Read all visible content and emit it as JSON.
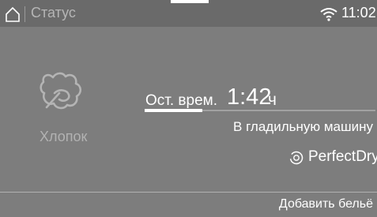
{
  "header": {
    "title": "Статус",
    "time": "11:02",
    "home_icon": "home-icon",
    "wifi_icon": "wifi-icon"
  },
  "program": {
    "name": "Хлопок",
    "icon": "cotton-icon"
  },
  "remaining": {
    "label": "Ост. врем.",
    "value": "1:42",
    "unit": "ч",
    "progress_percent": 25
  },
  "hint": "В гладильную машину",
  "perfect_dry": {
    "label": "PerfectDry",
    "icon": "perfectdry-icon"
  },
  "add_laundry_label": "Добавить бельё",
  "colors": {
    "background": "#7d7d7d",
    "header": "#6a6a6a",
    "text": "#ffffff"
  }
}
